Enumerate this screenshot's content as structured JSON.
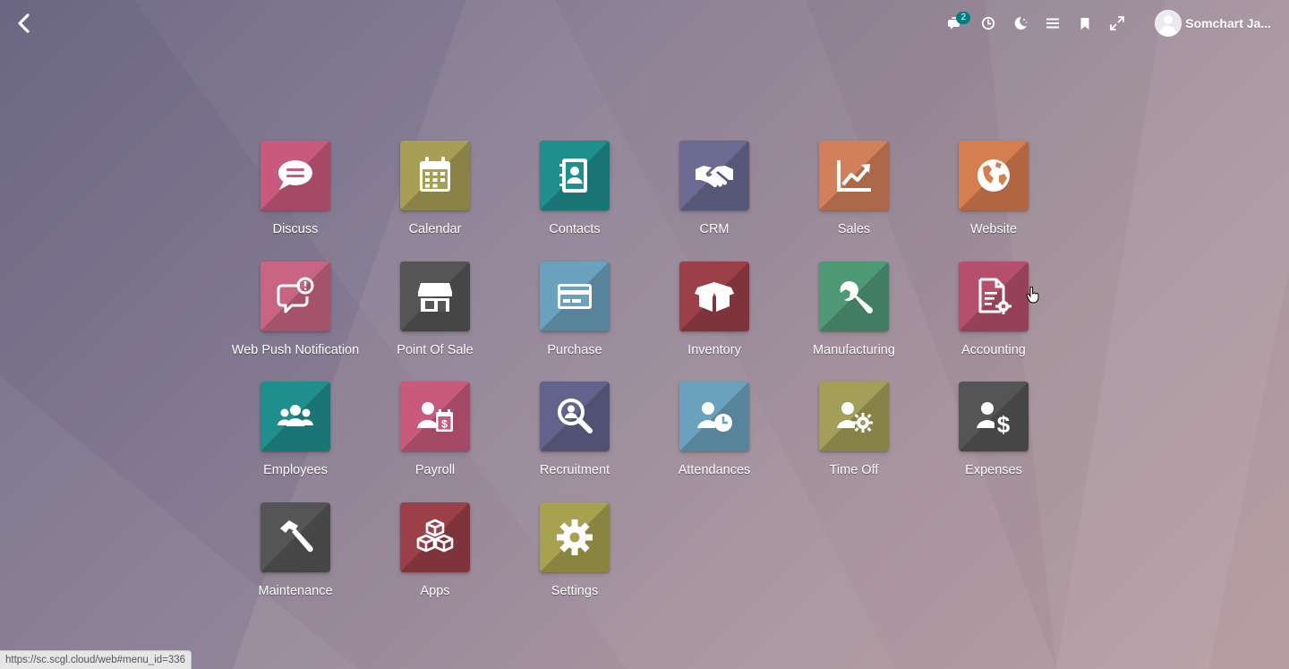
{
  "header": {
    "back_icon": "chevron-left-icon",
    "chat_badge": "2",
    "user_name": "Somchart Ja..."
  },
  "apps": [
    {
      "label": "Discuss",
      "color": "#c85a7d",
      "icon": "chat-icon"
    },
    {
      "label": "Calendar",
      "color": "#a89f55",
      "icon": "calendar-icon"
    },
    {
      "label": "Contacts",
      "color": "#1f8f8d",
      "icon": "address-book-icon"
    },
    {
      "label": "CRM",
      "color": "#6a6a92",
      "icon": "handshake-icon"
    },
    {
      "label": "Sales",
      "color": "#d2805a",
      "icon": "chart-line-icon"
    },
    {
      "label": "Website",
      "color": "#d77e4f",
      "icon": "globe-icon"
    },
    {
      "label": "Web Push Notification",
      "color": "#c96483",
      "icon": "notification-bubble-icon"
    },
    {
      "label": "Point Of Sale",
      "color": "#555555",
      "icon": "store-icon"
    },
    {
      "label": "Purchase",
      "color": "#6aa1bd",
      "icon": "credit-card-icon"
    },
    {
      "label": "Inventory",
      "color": "#9b3f48",
      "icon": "box-icon"
    },
    {
      "label": "Manufacturing",
      "color": "#4f9a76",
      "icon": "wrench-icon"
    },
    {
      "label": "Accounting",
      "color": "#b64f6e",
      "icon": "invoice-gear-icon"
    },
    {
      "label": "Employees",
      "color": "#1f8f8d",
      "icon": "users-icon"
    },
    {
      "label": "Payroll",
      "color": "#c85a7d",
      "icon": "user-calendar-dollar-icon"
    },
    {
      "label": "Recruitment",
      "color": "#62638c",
      "icon": "search-user-icon"
    },
    {
      "label": "Attendances",
      "color": "#6aa1bd",
      "icon": "user-clock-icon"
    },
    {
      "label": "Time Off",
      "color": "#a39f58",
      "icon": "user-gear-icon"
    },
    {
      "label": "Expenses",
      "color": "#555555",
      "icon": "user-dollar-icon"
    },
    {
      "label": "Maintenance",
      "color": "#555555",
      "icon": "hammer-icon"
    },
    {
      "label": "Apps",
      "color": "#9b3f48",
      "icon": "cubes-icon"
    },
    {
      "label": "Settings",
      "color": "#a8a14f",
      "icon": "gear-icon"
    }
  ],
  "status_url": "https://sc.scgl.cloud/web#menu_id=336"
}
